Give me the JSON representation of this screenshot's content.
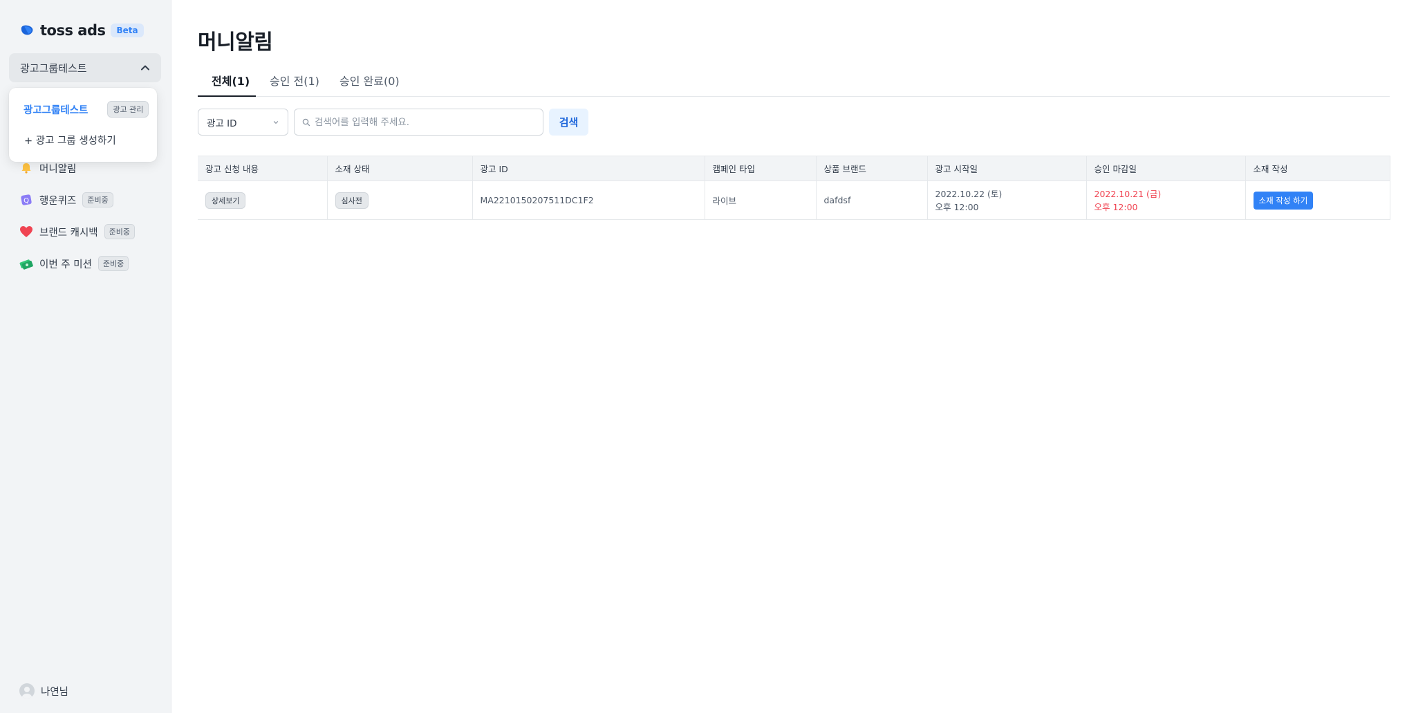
{
  "brand": {
    "name": "toss ads",
    "badge": "Beta"
  },
  "sidebar": {
    "group_selector": "광고그룹테스트",
    "nav": [
      {
        "label": "머니알림",
        "icon": "bell-icon",
        "badge": ""
      },
      {
        "label": "행운퀴즈",
        "icon": "quiz-icon",
        "badge": "준비중"
      },
      {
        "label": "브랜드 캐시백",
        "icon": "heart-icon",
        "badge": "준비중"
      },
      {
        "label": "이번 주 미션",
        "icon": "money-icon",
        "badge": "준비중"
      }
    ],
    "user": "나연님"
  },
  "dropdown": {
    "current_group": "광고그룹테스트",
    "manage_label": "광고 관리",
    "create_label": "+ 광고 그룹 생성하기"
  },
  "main": {
    "title": "머니알림",
    "tabs": [
      {
        "label": "전체(1)",
        "active": true
      },
      {
        "label": "승인 전(1)",
        "active": false
      },
      {
        "label": "승인 완료(0)",
        "active": false
      }
    ],
    "filter": {
      "select_value": "광고 ID",
      "search_placeholder": "검색어를 입력해 주세요.",
      "search_button": "검색"
    },
    "table": {
      "columns": [
        "광고 신청 내용",
        "소재 상태",
        "광고 ID",
        "캠페인 타입",
        "상품 브랜드",
        "광고 시작일",
        "승인 마감일",
        "소재 작성"
      ],
      "rows": [
        {
          "detail_button": "상세보기",
          "status": "심사전",
          "ad_id": "MA2210150207511DC1F2",
          "campaign_type": "라이브",
          "brand": "dafdsf",
          "start_date": "2022.10.22 (토)",
          "start_time": "오후 12:00",
          "deadline_date": "2022.10.21 (금)",
          "deadline_time": "오후 12:00",
          "create_button": "소재 작성 하기"
        }
      ]
    }
  },
  "colors": {
    "accent": "#3182f6",
    "deadline": "#f04452",
    "sidebar_bg": "#f2f4f6"
  }
}
